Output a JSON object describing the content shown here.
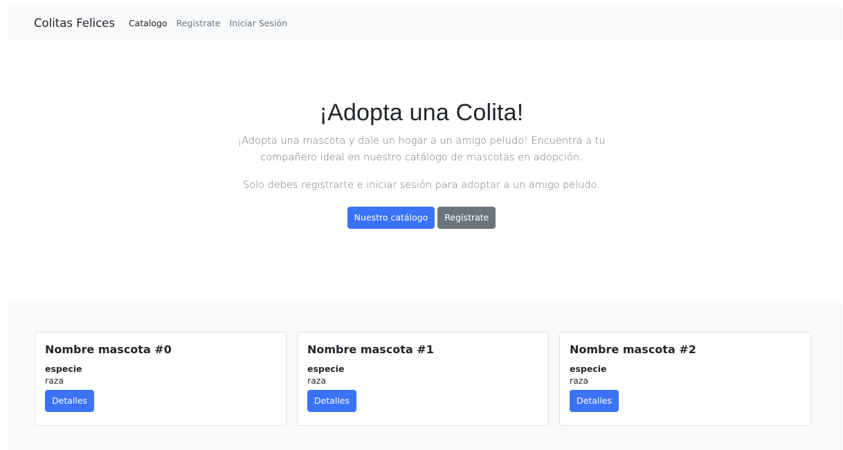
{
  "navbar": {
    "brand": "Colitas Felices",
    "links": [
      {
        "label": "Catalogo",
        "active": true
      },
      {
        "label": "Registrate",
        "active": false
      },
      {
        "label": "Iniciar Sesión",
        "active": false
      }
    ]
  },
  "hero": {
    "title": "¡Adopta una Colita!",
    "lead": "¡Adopta una mascota y dale un hogar a un amigo peludo! Encuentra a tu compañero ideal en nuestro catálogo de mascotas en adopción.",
    "lead2": "Solo debes registrarte e iniciar sesión para adoptar a un amigo peludo.",
    "primary_button": "Nuestro catálogo",
    "secondary_button": "Regístrate"
  },
  "cards": [
    {
      "title": "Nombre mascota #0",
      "species": "especie",
      "breed": "raza",
      "button": "Detalles"
    },
    {
      "title": "Nombre mascota #1",
      "species": "especie",
      "breed": "raza",
      "button": "Detalles"
    },
    {
      "title": "Nombre mascota #2",
      "species": "especie",
      "breed": "raza",
      "button": "Detalles"
    }
  ],
  "colors": {
    "primary": "#3a73f6",
    "secondary": "#6c757d",
    "navbar_bg": "#f8f9fa"
  }
}
